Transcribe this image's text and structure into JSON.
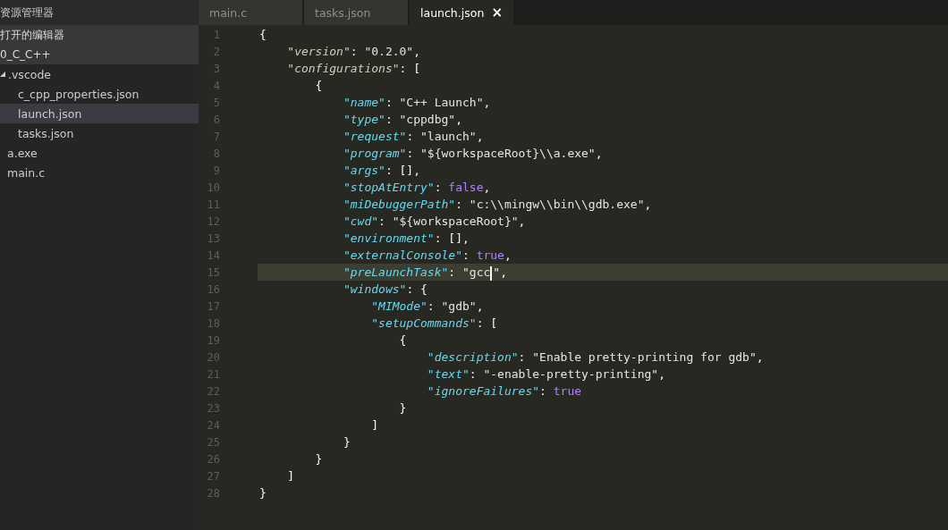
{
  "sidebar": {
    "title": "资源管理器",
    "sections": [
      {
        "label": "打开的编辑器"
      },
      {
        "label": "0_C_C++"
      }
    ],
    "tree": [
      {
        "label": ".vscode",
        "expanded": true,
        "selected": false,
        "children": [
          {
            "label": "c_cpp_properties.json",
            "selected": false
          },
          {
            "label": "launch.json",
            "selected": true
          },
          {
            "label": "tasks.json",
            "selected": false
          }
        ]
      },
      {
        "label": "a.exe",
        "selected": false
      },
      {
        "label": "main.c",
        "selected": false
      }
    ]
  },
  "tabs": [
    {
      "label": "main.c",
      "selected": false
    },
    {
      "label": "tasks.json",
      "selected": false
    },
    {
      "label": "launch.json",
      "selected": true,
      "close": "×"
    }
  ],
  "editor": {
    "lines": [
      {
        "number": "1",
        "current": false,
        "tokens": [
          {
            "kind": "punct",
            "text": "{"
          }
        ]
      },
      {
        "number": "2",
        "current": false,
        "tokens": [
          {
            "kind": "prop",
            "text": "    \"version\""
          },
          {
            "kind": "punct",
            "text": ": "
          },
          {
            "kind": "string",
            "text": "\"0.2.0\""
          },
          {
            "kind": "punct",
            "text": ","
          }
        ]
      },
      {
        "number": "3",
        "current": false,
        "tokens": [
          {
            "kind": "prop",
            "text": "    \"configurations\""
          },
          {
            "kind": "punct",
            "text": ": ["
          }
        ]
      },
      {
        "number": "4",
        "current": false,
        "tokens": [
          {
            "kind": "punct",
            "text": "        {"
          }
        ]
      },
      {
        "number": "5",
        "current": false,
        "tokens": [
          {
            "kind": "key",
            "text": "            \"name\""
          },
          {
            "kind": "punct",
            "text": ": "
          },
          {
            "kind": "string",
            "text": "\"C++ Launch\""
          },
          {
            "kind": "punct",
            "text": ","
          }
        ]
      },
      {
        "number": "6",
        "current": false,
        "tokens": [
          {
            "kind": "key",
            "text": "            \"type\""
          },
          {
            "kind": "punct",
            "text": ": "
          },
          {
            "kind": "string",
            "text": "\"cppdbg\""
          },
          {
            "kind": "punct",
            "text": ","
          }
        ]
      },
      {
        "number": "7",
        "current": false,
        "tokens": [
          {
            "kind": "key",
            "text": "            \"request\""
          },
          {
            "kind": "punct",
            "text": ": "
          },
          {
            "kind": "string",
            "text": "\"launch\""
          },
          {
            "kind": "punct",
            "text": ","
          }
        ]
      },
      {
        "number": "8",
        "current": false,
        "tokens": [
          {
            "kind": "key",
            "text": "            \"program\""
          },
          {
            "kind": "punct",
            "text": ": "
          },
          {
            "kind": "string",
            "text": "\"${workspaceRoot}\\\\a.exe\""
          },
          {
            "kind": "punct",
            "text": ","
          }
        ]
      },
      {
        "number": "9",
        "current": false,
        "tokens": [
          {
            "kind": "key",
            "text": "            \"args\""
          },
          {
            "kind": "punct",
            "text": ": [],"
          }
        ]
      },
      {
        "number": "10",
        "current": false,
        "tokens": [
          {
            "kind": "key",
            "text": "            \"stopAtEntry\""
          },
          {
            "kind": "punct",
            "text": ": "
          },
          {
            "kind": "bool",
            "text": "false"
          },
          {
            "kind": "punct",
            "text": ","
          }
        ]
      },
      {
        "number": "11",
        "current": false,
        "tokens": [
          {
            "kind": "key",
            "text": "            \"miDebuggerPath\""
          },
          {
            "kind": "punct",
            "text": ": "
          },
          {
            "kind": "string",
            "text": "\"c:\\\\mingw\\\\bin\\\\gdb.exe\""
          },
          {
            "kind": "punct",
            "text": ","
          }
        ]
      },
      {
        "number": "12",
        "current": false,
        "tokens": [
          {
            "kind": "key",
            "text": "            \"cwd\""
          },
          {
            "kind": "punct",
            "text": ": "
          },
          {
            "kind": "string",
            "text": "\"${workspaceRoot}\""
          },
          {
            "kind": "punct",
            "text": ","
          }
        ]
      },
      {
        "number": "13",
        "current": false,
        "tokens": [
          {
            "kind": "key",
            "text": "            \"environment\""
          },
          {
            "kind": "punct",
            "text": ": [],"
          }
        ]
      },
      {
        "number": "14",
        "current": false,
        "tokens": [
          {
            "kind": "key",
            "text": "            \"externalConsole\""
          },
          {
            "kind": "punct",
            "text": ": "
          },
          {
            "kind": "bool",
            "text": "true"
          },
          {
            "kind": "punct",
            "text": ","
          }
        ]
      },
      {
        "number": "15",
        "current": true,
        "tokens": [
          {
            "kind": "key",
            "text": "            \"preLaunchTask\""
          },
          {
            "kind": "punct",
            "text": ": "
          },
          {
            "kind": "string",
            "text": "\"gcc",
            "caret": true
          },
          {
            "kind": "string",
            "text": "\""
          },
          {
            "kind": "punct",
            "text": ","
          }
        ]
      },
      {
        "number": "16",
        "current": false,
        "tokens": [
          {
            "kind": "key",
            "text": "            \"windows\""
          },
          {
            "kind": "punct",
            "text": ": {"
          }
        ]
      },
      {
        "number": "17",
        "current": false,
        "tokens": [
          {
            "kind": "key",
            "text": "                \"MIMode\""
          },
          {
            "kind": "punct",
            "text": ": "
          },
          {
            "kind": "string",
            "text": "\"gdb\""
          },
          {
            "kind": "punct",
            "text": ","
          }
        ]
      },
      {
        "number": "18",
        "current": false,
        "tokens": [
          {
            "kind": "key",
            "text": "                \"setupCommands\""
          },
          {
            "kind": "punct",
            "text": ": ["
          }
        ]
      },
      {
        "number": "19",
        "current": false,
        "tokens": [
          {
            "kind": "punct",
            "text": "                    {"
          }
        ]
      },
      {
        "number": "20",
        "current": false,
        "tokens": [
          {
            "kind": "key",
            "text": "                        \"description\""
          },
          {
            "kind": "punct",
            "text": ": "
          },
          {
            "kind": "string",
            "text": "\"Enable pretty-printing for gdb\""
          },
          {
            "kind": "punct",
            "text": ","
          }
        ]
      },
      {
        "number": "21",
        "current": false,
        "tokens": [
          {
            "kind": "key",
            "text": "                        \"text\""
          },
          {
            "kind": "punct",
            "text": ": "
          },
          {
            "kind": "string",
            "text": "\"-enable-pretty-printing\""
          },
          {
            "kind": "punct",
            "text": ","
          }
        ]
      },
      {
        "number": "22",
        "current": false,
        "tokens": [
          {
            "kind": "key",
            "text": "                        \"ignoreFailures\""
          },
          {
            "kind": "punct",
            "text": ": "
          },
          {
            "kind": "bool",
            "text": "true"
          }
        ]
      },
      {
        "number": "23",
        "current": false,
        "tokens": [
          {
            "kind": "punct",
            "text": "                    }"
          }
        ]
      },
      {
        "number": "24",
        "current": false,
        "tokens": [
          {
            "kind": "punct",
            "text": "                ]"
          }
        ]
      },
      {
        "number": "25",
        "current": false,
        "tokens": [
          {
            "kind": "punct",
            "text": "            }"
          }
        ]
      },
      {
        "number": "26",
        "current": false,
        "tokens": [
          {
            "kind": "punct",
            "text": "        }"
          }
        ]
      },
      {
        "number": "27",
        "current": false,
        "tokens": [
          {
            "kind": "punct",
            "text": "    ]"
          }
        ]
      },
      {
        "number": "28",
        "current": false,
        "tokens": [
          {
            "kind": "punct",
            "text": "}"
          }
        ]
      }
    ]
  }
}
